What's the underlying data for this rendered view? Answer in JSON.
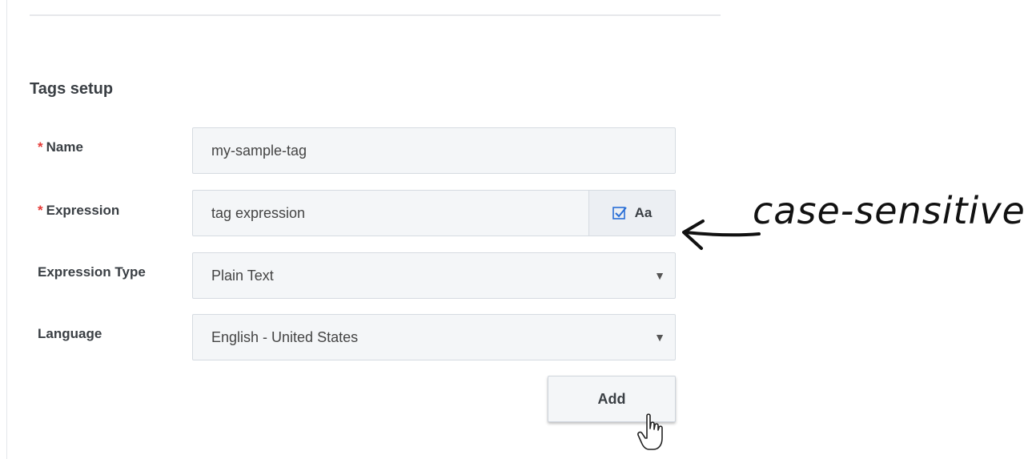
{
  "section": {
    "title": "Tags setup"
  },
  "form": {
    "required_marker": "*",
    "name": {
      "label": "Name",
      "value": "my-sample-tag"
    },
    "expression": {
      "label": "Expression",
      "value": "tag expression",
      "case_toggle_label": "Aa",
      "case_sensitive_checked": true
    },
    "expression_type": {
      "label": "Expression Type",
      "selected": "Plain Text"
    },
    "language": {
      "label": "Language",
      "selected": "English - United States"
    },
    "add_label": "Add"
  },
  "annotation": {
    "text": "case-sensitive"
  },
  "icons": {
    "checkbox": "checkbox-checked-icon",
    "dropdown": "caret-down-icon",
    "cursor": "hand-pointer-icon",
    "arrow": "arrow-left-icon"
  },
  "colors": {
    "required": "#e53935",
    "checkbox": "#2a6fd6",
    "field_bg": "#f4f6f8",
    "border": "#d6dbe1"
  }
}
